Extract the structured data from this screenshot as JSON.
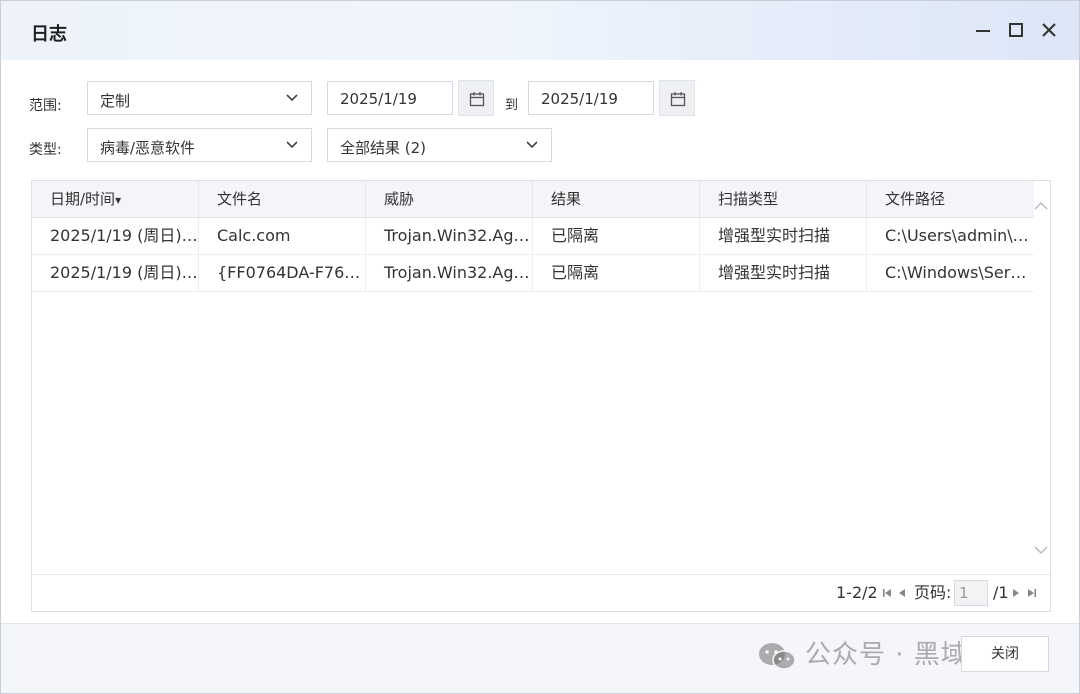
{
  "window": {
    "title": "日志"
  },
  "filters": {
    "range_label": "范围:",
    "range_value": "定制",
    "date_from": "2025/1/19",
    "to_label": "到",
    "date_to": "2025/1/19",
    "type_label": "类型:",
    "type_value": "病毒/恶意软件",
    "result_value": "全部结果 (2)"
  },
  "table": {
    "columns": [
      "日期/时间",
      "文件名",
      "威胁",
      "结果",
      "扫描类型",
      "文件路径"
    ],
    "sort_indicator": "▾",
    "rows": [
      [
        "2025/1/19 (周日) 1...",
        "Calc.com",
        "Trojan.Win32.Age...",
        "已隔离",
        "增强型实时扫描",
        "C:\\Users\\admin\\A..."
      ],
      [
        "2025/1/19 (周日) 1...",
        "{FF0764DA-F766-...",
        "Trojan.Win32.Age...",
        "已隔离",
        "增强型实时扫描",
        "C:\\Windows\\Servi..."
      ]
    ]
  },
  "pager": {
    "range": "1-2/2",
    "page_label": "页码:",
    "page_value": "1",
    "page_total": "/1"
  },
  "footer": {
    "close_label": "关闭",
    "watermark": "公众号 · 黑域之路"
  },
  "colors": {
    "accent": "#1a6fd4",
    "header_bg": "#f4f5f8",
    "border": "#d5dae2"
  }
}
